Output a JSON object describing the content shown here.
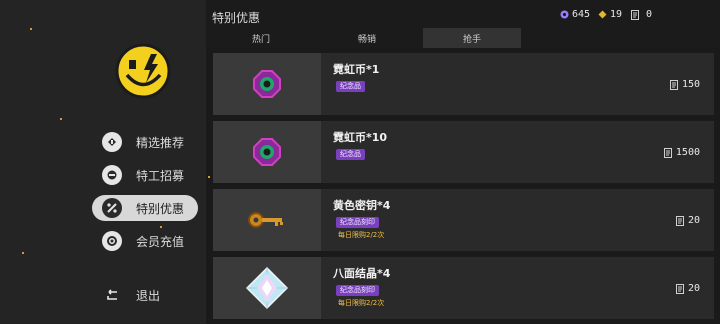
{
  "header": {
    "title": "特别优惠"
  },
  "currencies": [
    {
      "icon": "gem-icon",
      "value": "645",
      "color": "#9b7bff"
    },
    {
      "icon": "coin-icon",
      "value": "19",
      "color": "#e0b830"
    },
    {
      "icon": "ticket-icon",
      "value": "0",
      "color": "#d0d0d0"
    }
  ],
  "tabs": [
    {
      "label": "热门",
      "active": false
    },
    {
      "label": "畅销",
      "active": false
    },
    {
      "label": "抢手",
      "active": true
    }
  ],
  "sidebar": {
    "logo": "smiley-lightning-logo",
    "items": [
      {
        "label": "精选推荐",
        "icon": "recommend-icon",
        "active": false
      },
      {
        "label": "特工招募",
        "icon": "agent-icon",
        "active": false
      },
      {
        "label": "特别优惠",
        "icon": "offer-icon",
        "active": true
      },
      {
        "label": "会员充值",
        "icon": "member-icon",
        "active": false
      }
    ],
    "exit_label": "退出"
  },
  "products": [
    {
      "name": "霓虹币*1",
      "tags": [
        "纪念品"
      ],
      "limit": "",
      "price": "150",
      "icon": "neon-coin-icon"
    },
    {
      "name": "霓虹币*10",
      "tags": [
        "纪念品"
      ],
      "limit": "",
      "price": "1500",
      "icon": "neon-coin-icon"
    },
    {
      "name": "黄色密钥*4",
      "tags": [
        "纪念品刻印"
      ],
      "limit": "每日限购2/2次",
      "price": "20",
      "icon": "yellow-key-icon"
    },
    {
      "name": "八面结晶*4",
      "tags": [
        "纪念品刻印"
      ],
      "limit": "每日限购2/2次",
      "price": "20",
      "icon": "octahedron-crystal-icon"
    }
  ]
}
